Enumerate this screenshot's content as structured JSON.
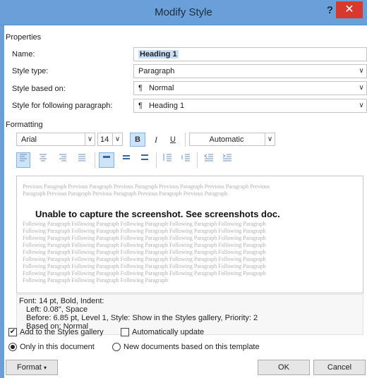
{
  "window": {
    "title": "Modify Style",
    "help": "?",
    "close": "✕"
  },
  "properties": {
    "section": "Properties",
    "name_label": "Name:",
    "name_value": "Heading 1",
    "style_type_label": "Style type:",
    "style_type_value": "Paragraph",
    "based_on_label": "Style based on:",
    "based_on_value": "Normal",
    "following_label": "Style for following paragraph:",
    "following_value": "Heading 1",
    "para_glyph": "¶"
  },
  "formatting": {
    "section": "Formatting",
    "font": "Arial",
    "size": "14",
    "bold": "B",
    "italic": "I",
    "underline": "U",
    "color": "Automatic"
  },
  "preview": {
    "previous_1": "Previous Paragraph Previous Paragraph Previous Paragraph Previous Paragraph Previous Paragraph Previous",
    "previous_2": "Paragraph Previous Paragraph Previous Paragraph Previous Paragraph Previous Paragraph",
    "main": "Unable to capture the screenshot. See screenshots doc.",
    "following": "Following Paragraph Following Paragraph Following Paragraph Following Paragraph Following Paragraph",
    "following_last": "Following Paragraph Following Paragraph Following Paragraph"
  },
  "description": {
    "line1": "Font: 14 pt, Bold, Indent:",
    "line2": "Left: 0.08\", Space",
    "line3": "Before: 6.85 pt, Level 1, Style: Show in the Styles gallery, Priority: 2",
    "line4": "Based on: Normal"
  },
  "options": {
    "add_gallery": "Add to the Styles gallery",
    "add_gallery_checked": true,
    "auto_update": "Automatically update",
    "auto_update_checked": false,
    "only_doc": "Only in this document",
    "new_docs": "New documents based on this template"
  },
  "buttons": {
    "format": "Format",
    "ok": "OK",
    "cancel": "Cancel"
  }
}
